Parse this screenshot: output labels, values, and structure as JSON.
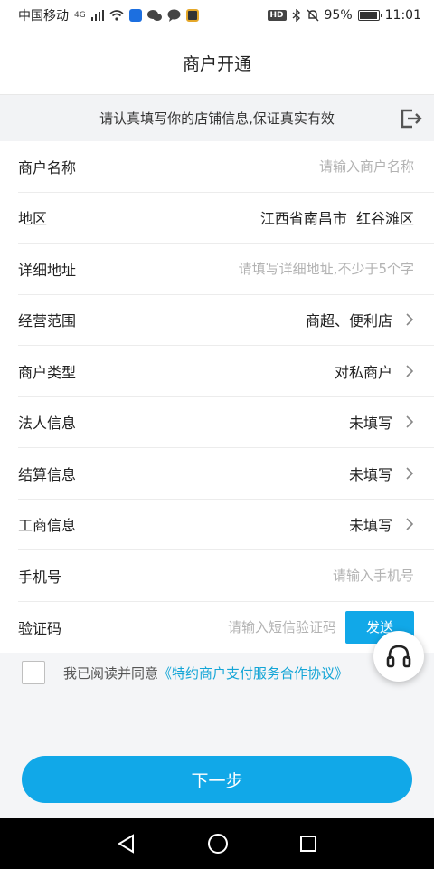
{
  "status_bar": {
    "carrier": "中国移动",
    "network": "4G",
    "hd_badge": "HD",
    "battery_percent": "95%",
    "battery_level": 0.95,
    "time": "11:01"
  },
  "nav": {
    "title": "商户开通"
  },
  "notice": {
    "text": "请认真填写你的店铺信息,保证真实有效"
  },
  "form": {
    "rows": [
      {
        "label": "商户名称",
        "placeholder": "请输入商户名称"
      },
      {
        "label": "地区",
        "value": "江西省南昌市  红谷滩区"
      },
      {
        "label": "详细地址",
        "placeholder": "请填写详细地址,不少于5个字"
      },
      {
        "label": "经营范围",
        "value": "商超、便利店"
      },
      {
        "label": "商户类型",
        "value": "对私商户"
      },
      {
        "label": "法人信息",
        "value": "未填写"
      },
      {
        "label": "结算信息",
        "value": "未填写"
      },
      {
        "label": "工商信息",
        "value": "未填写"
      },
      {
        "label": "手机号",
        "placeholder": "请输入手机号"
      },
      {
        "label": "验证码",
        "placeholder": "请输入短信验证码",
        "send_label": "发送"
      }
    ]
  },
  "agreement": {
    "prefix": "我已阅读并同意",
    "link": "《特约商户支付服务合作协议》"
  },
  "next_button": {
    "label": "下一步"
  },
  "colors": {
    "accent": "#11a8e8",
    "link": "#13a5d6"
  }
}
